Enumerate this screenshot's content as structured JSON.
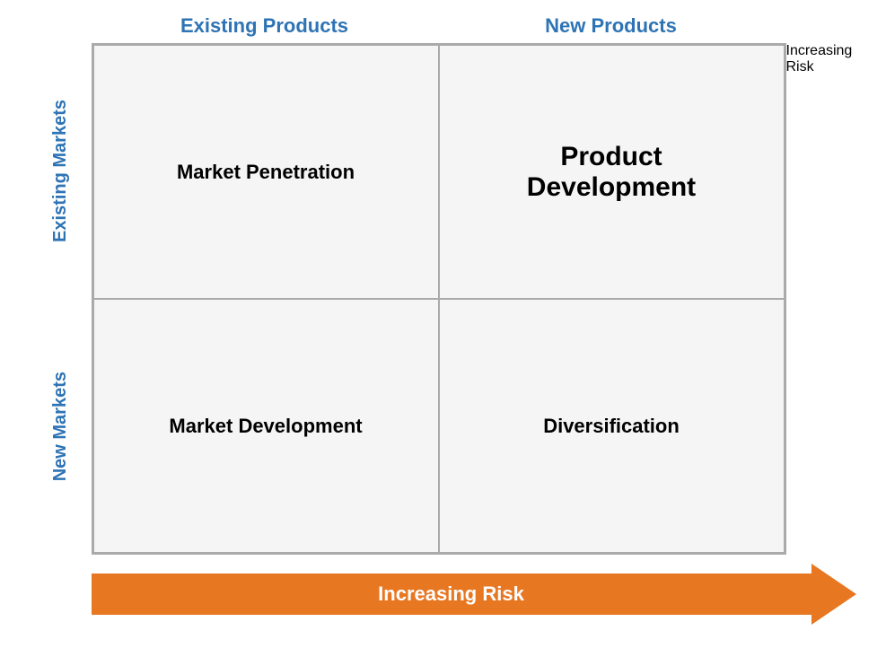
{
  "columns": {
    "existing": "Existing Products",
    "new": "New Products"
  },
  "rows": {
    "existing": "Existing Markets",
    "new": "New Markets"
  },
  "cells": {
    "top_left": "Market Penetration",
    "top_right": "Product\nDevelopment",
    "bottom_left": "Market Development",
    "bottom_right": "Diversification"
  },
  "arrows": {
    "horizontal": "Increasing Risk",
    "vertical": "Increasing Risk"
  },
  "colors": {
    "header": "#2E74B5",
    "arrow": "#E87722",
    "arrow_text": "#ffffff",
    "cell_bg": "#f5f5f5",
    "border": "#aaaaaa",
    "cell_text": "#000000"
  }
}
